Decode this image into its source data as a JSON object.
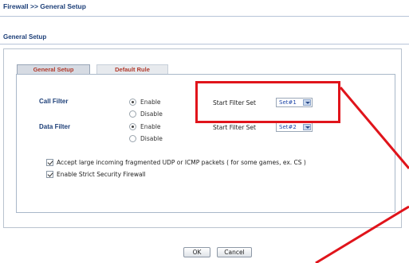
{
  "breadcrumb": "Firewall >> General Setup",
  "section_title": "General Setup",
  "tabs": [
    {
      "label": "General Setup",
      "active": true
    },
    {
      "label": "Default Rule",
      "active": false
    }
  ],
  "call_filter": {
    "label": "Call Filter",
    "options": [
      "Enable",
      "Disable"
    ],
    "selected": "Enable",
    "start_filter_label": "Start Filter Set",
    "start_filter_value": "Set#1"
  },
  "data_filter": {
    "label": "Data Filter",
    "options": [
      "Enable",
      "Disable"
    ],
    "selected": "Enable",
    "start_filter_label": "Start Filter Set",
    "start_filter_value": "Set#2"
  },
  "checkboxes": [
    {
      "label": "Accept large incoming fragmented UDP or ICMP packets ( for some games, ex. CS )",
      "checked": true
    },
    {
      "label": "Enable Strict Security Firewall",
      "checked": true
    }
  ],
  "buttons": {
    "ok": "OK",
    "cancel": "Cancel"
  },
  "colors": {
    "accent_title": "#1d3f78",
    "tab_text": "#b13a2c",
    "highlight": "#e0141b"
  }
}
